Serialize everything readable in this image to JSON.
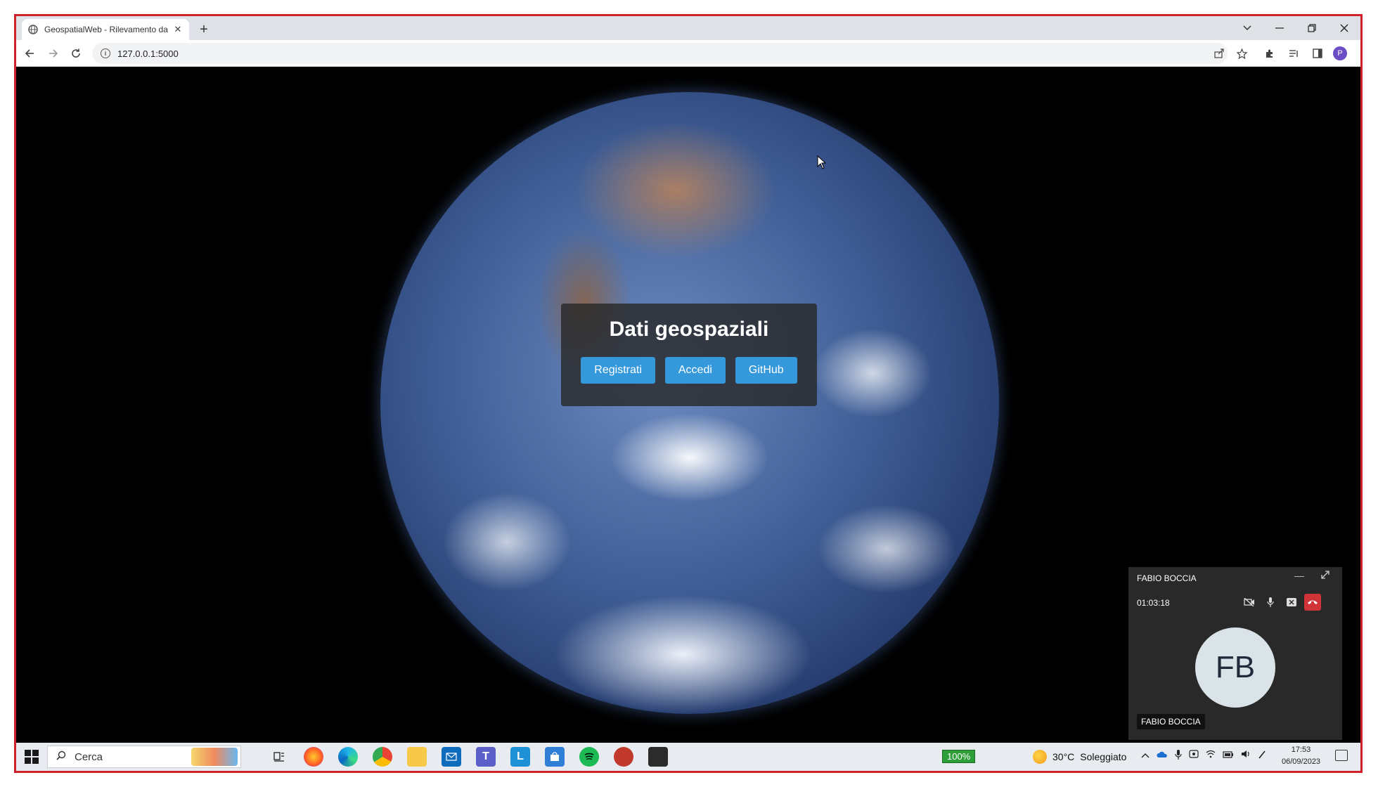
{
  "browser": {
    "tab_title": "GeospatialWeb - Rilevamento da",
    "tab_close": "✕",
    "new_tab": "+",
    "url": "127.0.0.1:5000"
  },
  "page": {
    "heading": "Dati geospaziali",
    "buttons": [
      "Registrati",
      "Accedi",
      "GitHub"
    ],
    "button_color": "#3498db"
  },
  "call": {
    "caller_name": "FABIO BOCCIA",
    "duration": "01:03:18",
    "initials": "FB",
    "name_tag": "FABIO BOCCIA",
    "hangup_color": "#d13438"
  },
  "taskbar": {
    "search_placeholder": "Cerca",
    "battery": "100%",
    "temperature": "30°C",
    "weather": "Soleggiato",
    "time": "17:53",
    "date": "06/09/2023",
    "apps": [
      "task-view-icon",
      "firefox-icon",
      "edge-icon",
      "chrome-icon",
      "file-explorer-icon",
      "mail-icon",
      "teams-icon",
      "l-app-icon",
      "store-icon",
      "spotify-icon",
      "bug-app-icon",
      "terminal-icon"
    ]
  }
}
